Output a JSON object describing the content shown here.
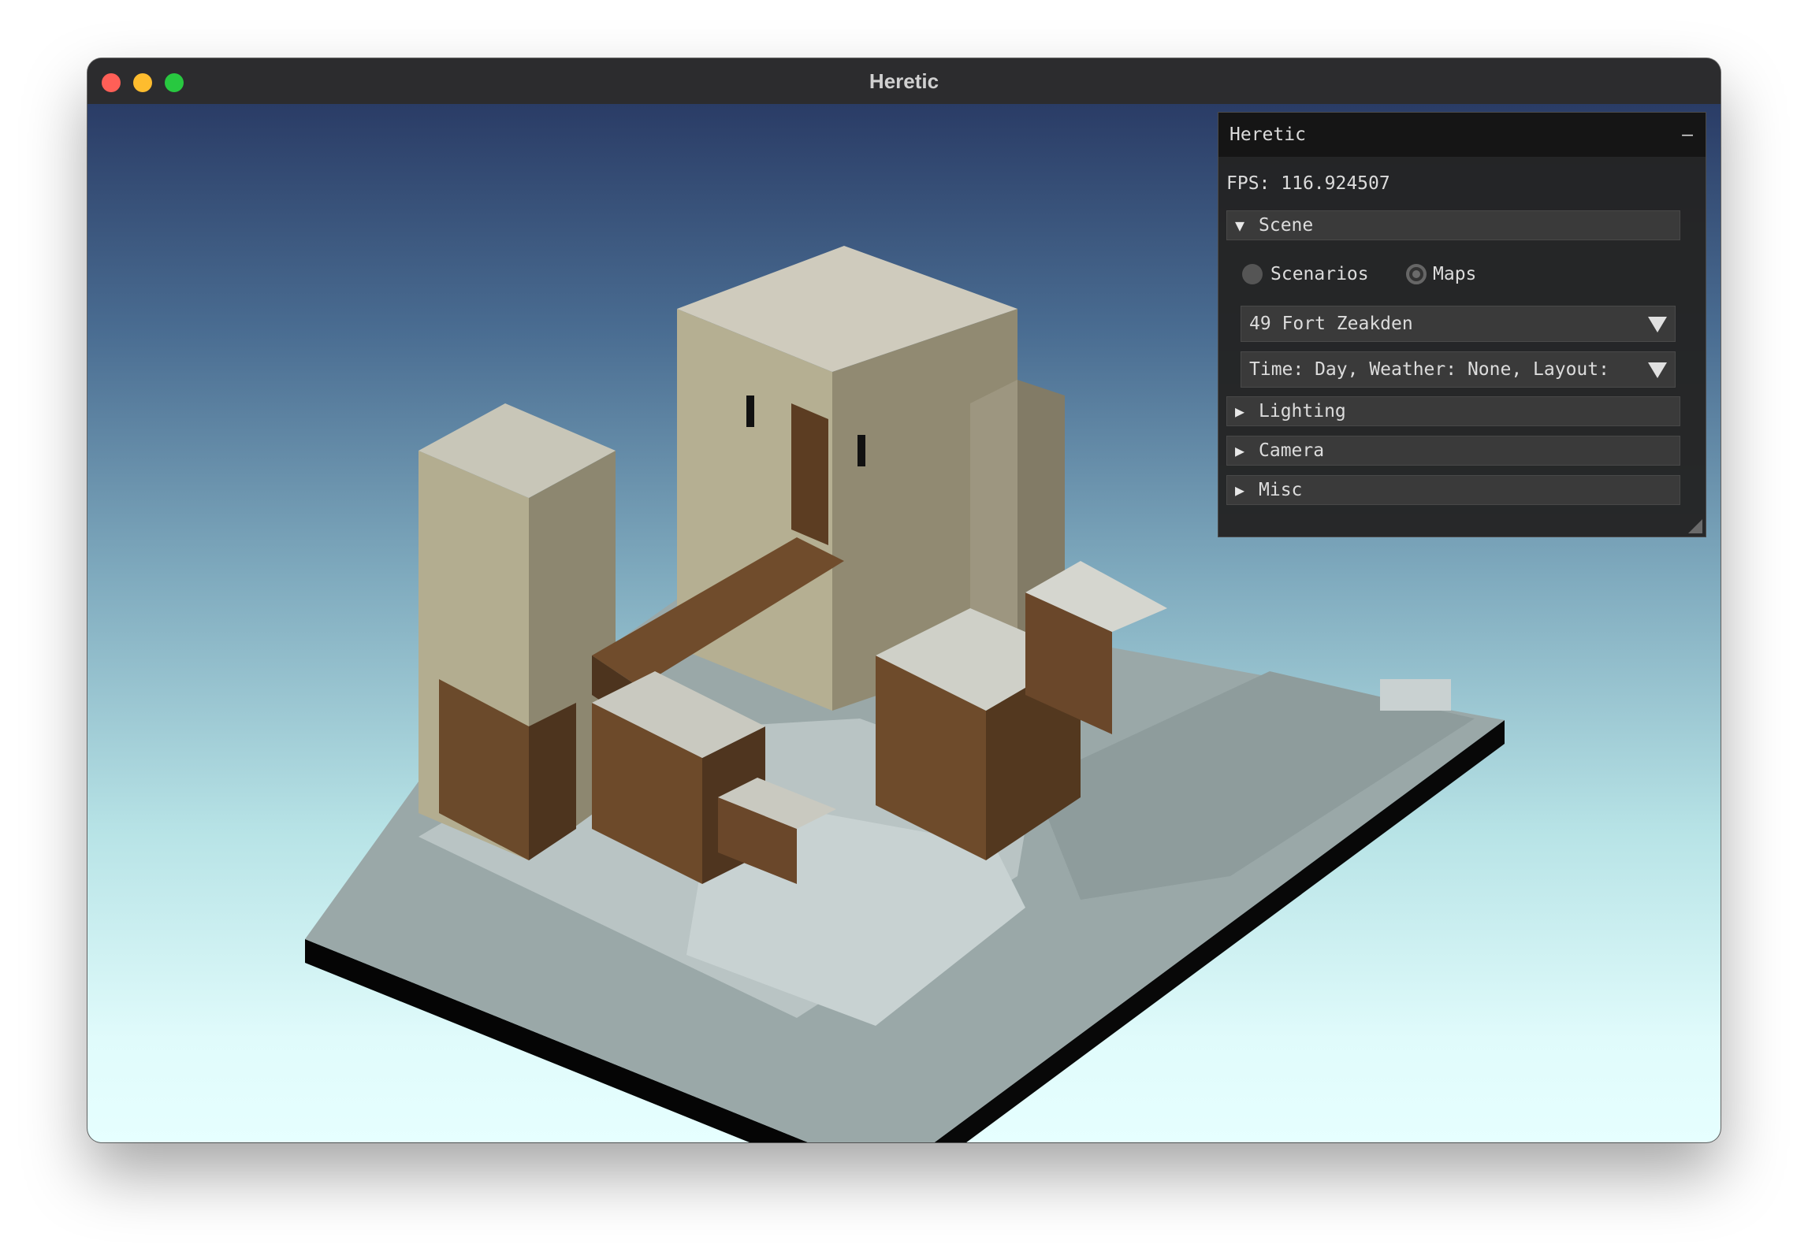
{
  "window": {
    "title": "Heretic",
    "controls": [
      "close",
      "minimize",
      "maximize"
    ]
  },
  "panel": {
    "title": "Heretic",
    "collapse_glyph": "–",
    "fps_label": "FPS:",
    "fps_value": "116.924507",
    "sections": {
      "scene": {
        "label": "Scene",
        "expanded": true
      },
      "lighting": {
        "label": "Lighting",
        "expanded": false
      },
      "camera": {
        "label": "Camera",
        "expanded": false
      },
      "misc": {
        "label": "Misc",
        "expanded": false
      }
    },
    "source_radio": {
      "options": [
        "Scenarios",
        "Maps"
      ],
      "selected": "Maps"
    },
    "map_combo": {
      "value": "49 Fort Zeakden"
    },
    "layout_combo": {
      "value": "Time: Day, Weather: None, Layout:"
    },
    "icons": {
      "expanded": "triangle-down-icon",
      "collapsed": "triangle-right-icon",
      "combo": "combo-arrow-icon",
      "resize": "resize-grip-icon"
    }
  },
  "scene": {
    "description_visible_only": false
  },
  "colors": {
    "sky_top": "#2a3c66",
    "sky_bottom": "#e6ffff",
    "panel_bg": "#242424",
    "header_bg": "#3a3a3a",
    "close": "#ff5f57",
    "minimize": "#febc2e",
    "maximize": "#28c840"
  }
}
